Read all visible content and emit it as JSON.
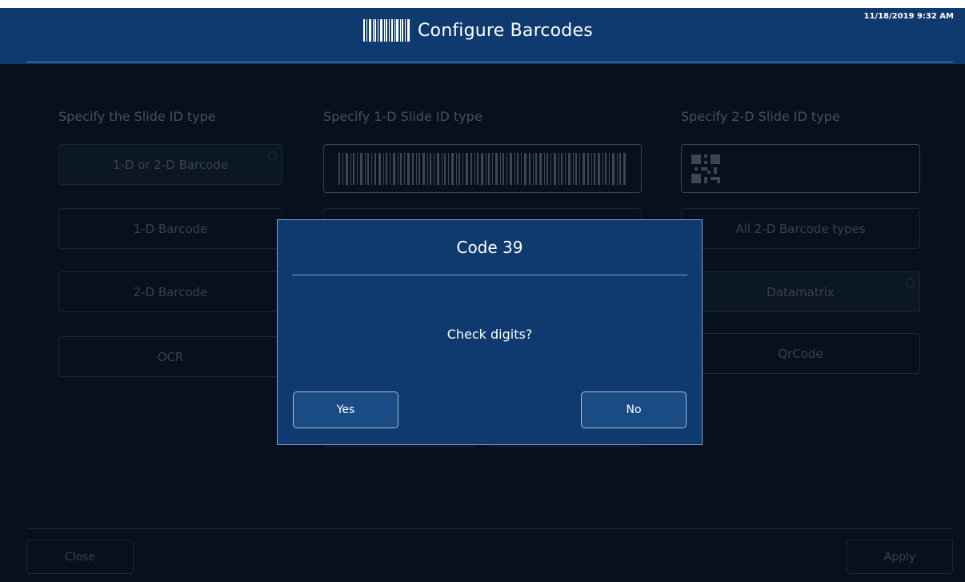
{
  "header": {
    "title": "Configure Barcodes",
    "datetime": "11/18/2019 9:32 AM",
    "icon": "barcode-icon"
  },
  "columns": {
    "slide_id": {
      "heading": "Specify the Slide ID type",
      "options": [
        {
          "label": "1-D or 2-D Barcode",
          "selected": true
        },
        {
          "label": "1-D Barcode",
          "selected": false
        },
        {
          "label": "2-D Barcode",
          "selected": false
        },
        {
          "label": "OCR",
          "selected": false
        }
      ]
    },
    "one_d": {
      "heading": "Specify 1-D Slide ID type"
    },
    "two_d": {
      "heading": "Specify 2-D Slide ID type",
      "options": [
        {
          "label": "All 2-D Barcode types",
          "selected": false
        },
        {
          "label": "Datamatrix",
          "selected": true
        },
        {
          "label": "QrCode",
          "selected": false
        }
      ]
    }
  },
  "footer": {
    "close_label": "Close",
    "apply_label": "Apply"
  },
  "dialog": {
    "title": "Code 39",
    "message": "Check digits?",
    "yes_label": "Yes",
    "no_label": "No"
  },
  "colors": {
    "header_bg": "#0f3a70",
    "dialog_bg": "#0f3a70",
    "main_bg": "#06101f",
    "button_bg": "#1a4b85"
  }
}
